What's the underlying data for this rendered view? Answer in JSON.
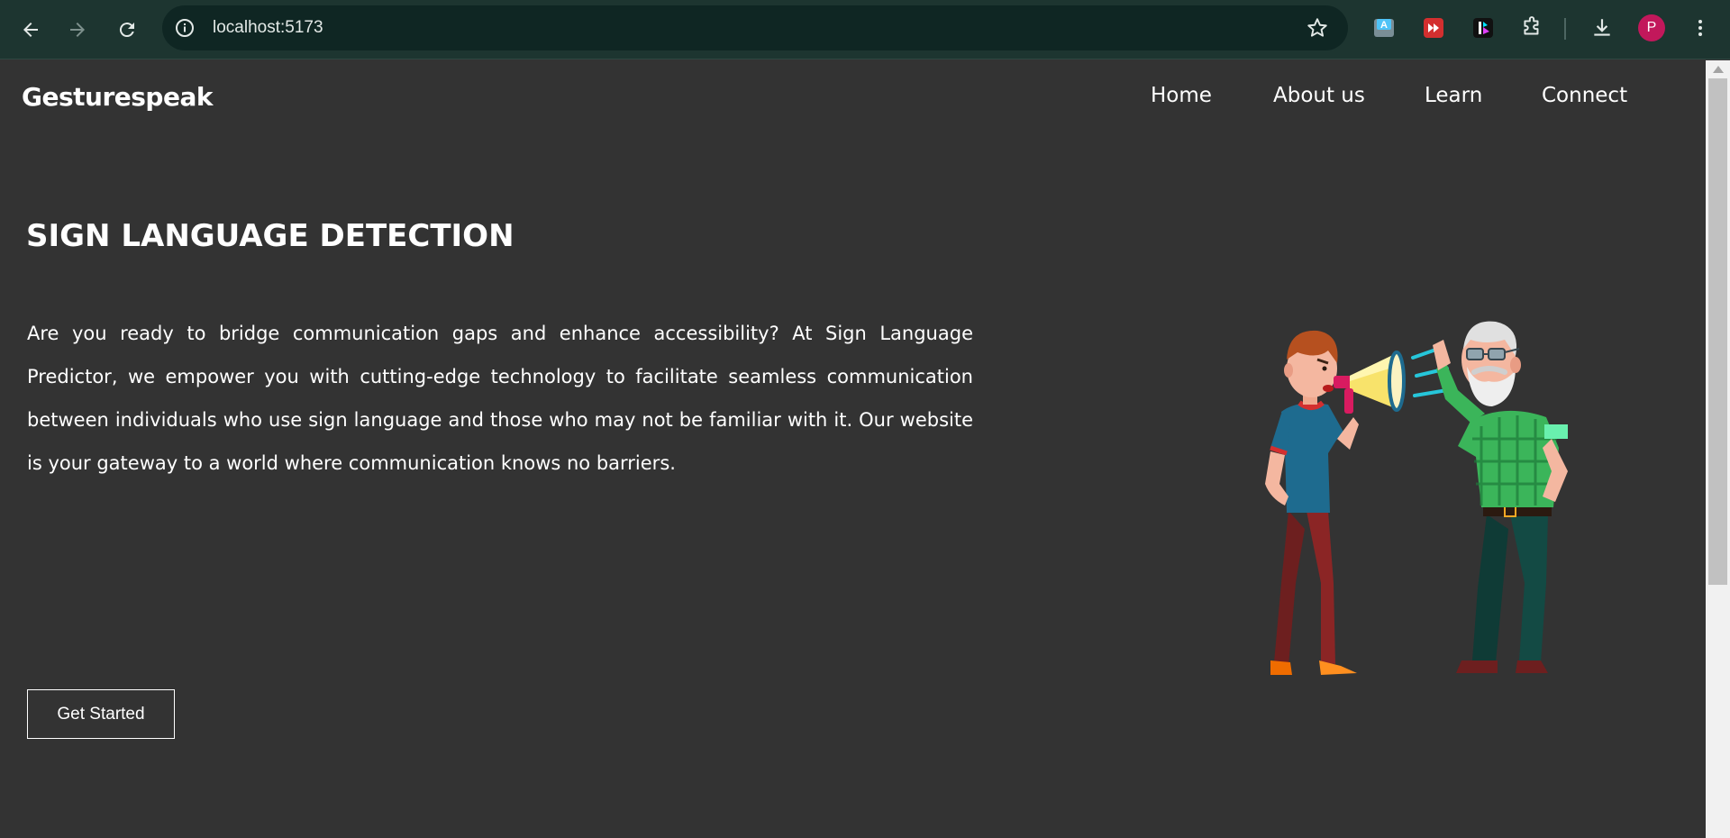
{
  "browser": {
    "url": "localhost:5173",
    "profile_initial": "P",
    "colors": {
      "chrome": "#1d3530",
      "omnibox": "#0f2623",
      "avatar": "#c2185b"
    },
    "icons": [
      "back-arrow-icon",
      "forward-arrow-icon",
      "reload-icon",
      "site-info-icon",
      "bookmark-star-icon",
      "translate-extension-icon",
      "video-speed-extension-icon",
      "media-extension-icon",
      "extensions-puzzle-icon",
      "downloads-icon",
      "more-vert-icon"
    ]
  },
  "site": {
    "brand": "Gesturespeak",
    "nav": [
      "Home",
      "About us",
      "Learn",
      "Connect"
    ],
    "background": "#333333"
  },
  "hero": {
    "title": "SIGN LANGUAGE DETECTION",
    "description": "Are you ready to bridge communication gaps and enhance accessibility? At Sign Language Predictor, we empower you with cutting-edge technology to facilitate seamless communication between individuals who use sign language and those who may not be familiar with it. Our website is your gateway to a world where communication knows no barriers.",
    "cta_label": "Get Started",
    "illustration": "young man shouting through a megaphone at an elderly man cupping his ear"
  }
}
